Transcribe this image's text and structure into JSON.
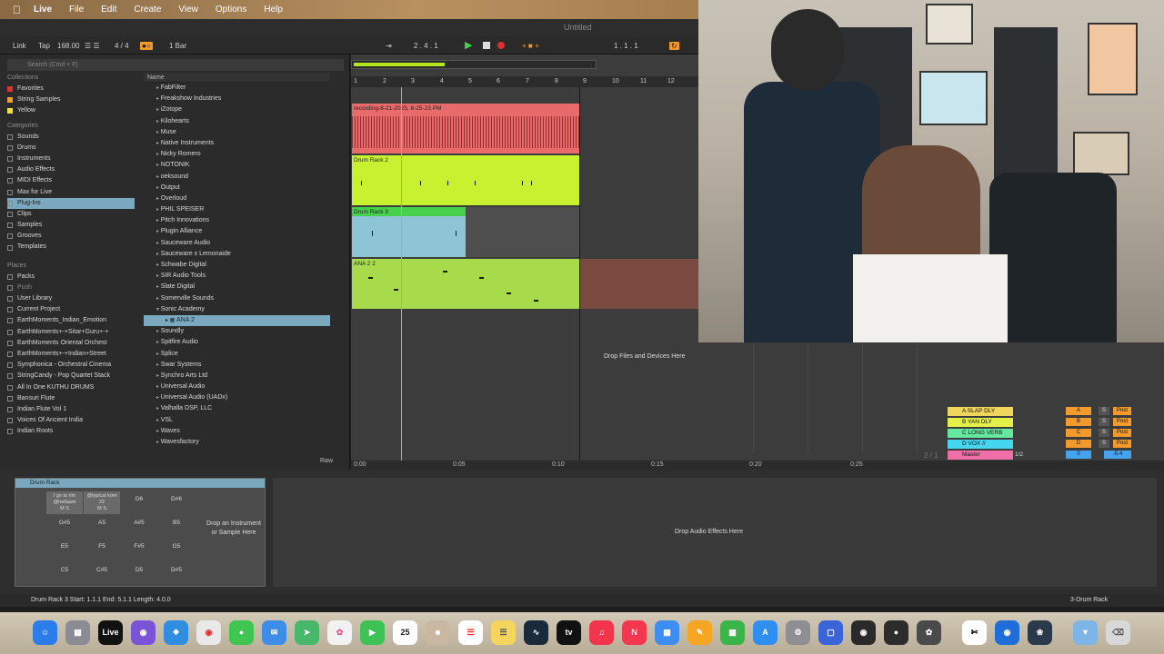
{
  "menubar": {
    "apple": "",
    "items": [
      "Live",
      "File",
      "Edit",
      "Create",
      "View",
      "Options",
      "Help"
    ]
  },
  "window": {
    "title": "Untitled"
  },
  "transport": {
    "link": "Link",
    "tap": "Tap",
    "tempo": "168.00",
    "signature": "4 / 4",
    "quantize": "1 Bar",
    "position": "2 .  4 .  1",
    "loop_start": "1 .  1 .  1"
  },
  "browser": {
    "search_placeholder": "Search (Cmd + F)",
    "collections_header": "Collections",
    "collections": [
      {
        "label": "Favorites",
        "color": "red"
      },
      {
        "label": "String Samples",
        "color": "orange"
      },
      {
        "label": "Yellow",
        "color": "yellow"
      }
    ],
    "categories_header": "Categories",
    "categories": [
      "Sounds",
      "Drums",
      "Instruments",
      "Audio Effects",
      "MIDI Effects",
      "Max for Live",
      "Plug-Ins",
      "Clips",
      "Samples",
      "Grooves",
      "Templates"
    ],
    "selected_category": "Plug-Ins",
    "places_header": "Places",
    "places": [
      "Packs",
      "Push",
      "User Library",
      "Current Project",
      "EarthMoments_Indian_Emotion",
      "EarthMoments+-+Sitar+Guru+-+",
      "EarthMoments Oriental Orchest",
      "EarthMoments+-+Indian+Street",
      "Symphonica - Orchestral Cinema",
      "StringCandy - Pop Quartet Stack",
      "All In One KUTHU DRUMS",
      "Bansuri Flute",
      "Indian Flute Vol 1",
      "Voices Of Ancient India",
      "Indian Roots"
    ],
    "name_header": "Name",
    "files": [
      "FabFilter",
      "Freakshow Industries",
      "iZotope",
      "Kilohearts",
      "Muse",
      "Native Instruments",
      "Nicky Romero",
      "NOTONIK",
      "oeksound",
      "Output",
      "Overloud",
      "PHIL SPEISER",
      "Pitch Innovations",
      "Plugin Alliance",
      "Sauceware Audio",
      "Sauceware x Lemonaide",
      "Schwabe Digital",
      "SIR Audio Tools",
      "Slate Digital",
      "Somerville Sounds",
      "Sonic Academy",
      "ANA 2",
      "Soundly",
      "Spitfire Audio",
      "Splice",
      "Swar Systems",
      "Synchro Arts Ltd",
      "Universal Audio",
      "Universal Audio (UADx)",
      "Valhalla DSP, LLC",
      "VSL",
      "Waves",
      "Wavesfactory"
    ],
    "raw_label": "Raw"
  },
  "arrangement": {
    "bar_numbers": [
      "1",
      "2",
      "3",
      "4",
      "5",
      "6",
      "7",
      "8",
      "9",
      "10",
      "11",
      "12"
    ],
    "clips": {
      "recording": "recording-8-21-2025, 8-25-23 PM",
      "drum_rack_2": "Drum Rack 2",
      "drum_rack_3": "Drum Rack 3",
      "ana22": "ANA 2 2"
    },
    "drop_files": "Drop Files and Devices Here",
    "time_labels": [
      "0:00",
      "0:05",
      "0:10",
      "0:15",
      "0:20",
      "0:25"
    ]
  },
  "mixer": {
    "returns": [
      {
        "name": "A SLAP DLY",
        "letter": "A",
        "color": "#f0d65c"
      },
      {
        "name": "B YAN DLY",
        "letter": "B",
        "color": "#e4f047"
      },
      {
        "name": "C LONG VERB",
        "letter": "C",
        "color": "#66e7a0"
      },
      {
        "name": "D VOX //",
        "letter": "D",
        "color": "#45d6f0"
      },
      {
        "name": "Master",
        "letter": "0",
        "color": "#f06fa8"
      }
    ],
    "solo": "S",
    "post": "Post",
    "master_value": "1/2",
    "master_volume": "-5.4",
    "page_indicator": "2 / 1"
  },
  "device": {
    "title": "Drum Rack",
    "pads": [
      [
        "I go to rim @hellaam",
        "@typical kom 22",
        "D6",
        "D#6"
      ],
      [
        "G#5",
        "A5",
        "A#5",
        "B5"
      ],
      [
        "E5",
        "F5",
        "F#5",
        "G5"
      ],
      [
        "C5",
        "C#5",
        "D5",
        "D#5"
      ]
    ],
    "pad_ms": "M  S",
    "drop_instrument": "Drop an Instrument or Sample Here",
    "drop_effects": "Drop Audio Effects Here"
  },
  "status": {
    "text": "Drum Rack 3  Start: 1.1.1  End: 5.1.1  Length: 4.0.0",
    "track": "3-Drum Rack"
  },
  "dock": {
    "calendar_day": "25"
  }
}
